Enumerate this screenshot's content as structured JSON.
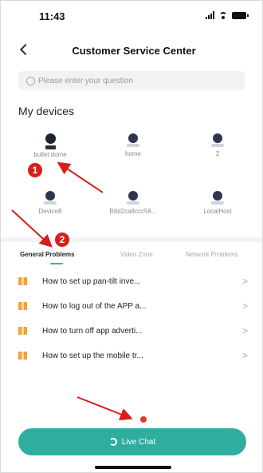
{
  "status_bar": {
    "time": "11:43"
  },
  "header": {
    "title": "Customer Service Center"
  },
  "search": {
    "placeholder": "Please enter your question"
  },
  "devices_section": {
    "title": "My devices",
    "devices": [
      {
        "label": "bullet dome",
        "icon": "bullet-camera-icon"
      },
      {
        "label": "home",
        "icon": "dome-camera-icon"
      },
      {
        "label": "2",
        "icon": "dome-camera-icon"
      },
      {
        "label": "Device8",
        "icon": "dome-camera-icon"
      },
      {
        "label": "B8d2ca8ccc56...",
        "icon": "dome-camera-icon"
      },
      {
        "label": "LocalHost",
        "icon": "dome-camera-icon"
      }
    ]
  },
  "tabs": {
    "items": [
      "General Problems",
      "Video Zone",
      "Network Problems"
    ],
    "active_index": 0
  },
  "faq": {
    "items": [
      "How to set up pan-tilt inve...",
      "How to log out of the APP a...",
      "How to turn off app adverti...",
      "How to set up the mobile tr..."
    ]
  },
  "live_chat": {
    "label": "Live Chat"
  },
  "annotations": {
    "marker1": "1",
    "marker2": "2"
  },
  "colors": {
    "accent": "#2fae9f",
    "annotation": "#d41f1a",
    "faq_icon": "#f0a23a"
  }
}
